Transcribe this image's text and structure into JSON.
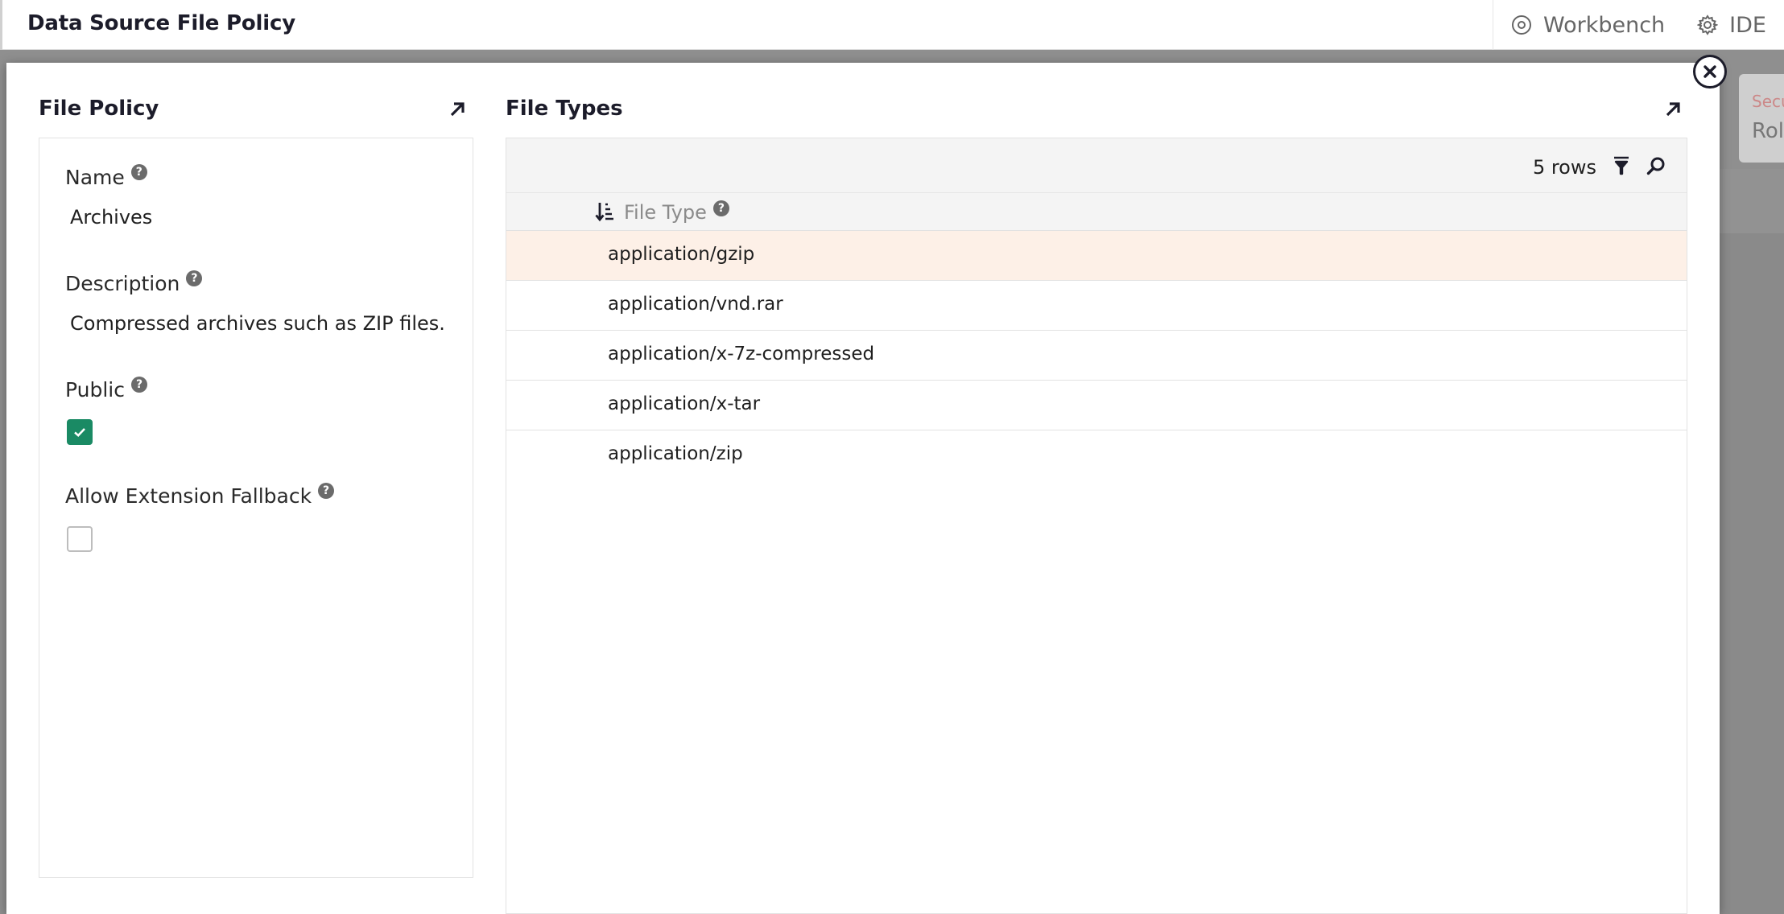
{
  "header": {
    "title": "Data Source File Policy",
    "actions": [
      {
        "label": "Workbench",
        "icon": "workbench-icon"
      },
      {
        "label": "IDE",
        "icon": "gear-icon"
      }
    ]
  },
  "background": {
    "card_subtitle": "Secu",
    "card_title": "Rol"
  },
  "file_policy": {
    "section_title": "File Policy",
    "fields": {
      "name": {
        "label": "Name",
        "value": "Archives"
      },
      "description": {
        "label": "Description",
        "value": "Compressed archives such as ZIP files."
      },
      "public": {
        "label": "Public",
        "checked": true
      },
      "allow_extension_fallback": {
        "label": "Allow Extension Fallback",
        "checked": false
      }
    }
  },
  "file_types": {
    "section_title": "File Types",
    "row_count": "5 rows",
    "column_header": "File Type",
    "rows": [
      "application/gzip",
      "application/vnd.rar",
      "application/x-7z-compressed",
      "application/x-tar",
      "application/zip"
    ],
    "selected_row_index": 0
  },
  "colors": {
    "checkbox_checked": "#1a8a64",
    "selected_row": "#fdf0e7",
    "title_text": "#1c1c2a"
  }
}
